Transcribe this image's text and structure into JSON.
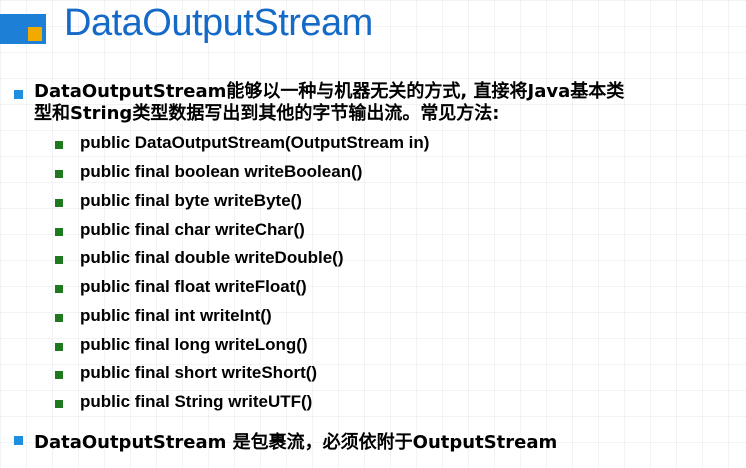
{
  "slide": {
    "title": "DataOutputStream",
    "intro_line1": "DataOutputStream能够以一种与机器无关的方式, 直接将Java基本类",
    "intro_line2": "型和String类型数据写出到其他的字节输出流。常见方法:",
    "methods": [
      "public DataOutputStream(OutputStream in)",
      "public final boolean writeBoolean()",
      "public final byte writeByte()",
      "public final char writeChar()",
      "public final double writeDouble()",
      "public final float writeFloat()",
      "public final int writeInt()",
      "public final long writeLong()",
      "public final short writeShort()",
      "public final String writeUTF()"
    ],
    "footer_point": "DataOutputStream 是包裹流，必须依附于OutputStream"
  },
  "colors": {
    "title": "#1569c7",
    "logo_blue": "#1e7fd6",
    "logo_orange": "#f2a900",
    "bullet_blue": "#1e8fe0",
    "bullet_green": "#1f7a1f"
  }
}
